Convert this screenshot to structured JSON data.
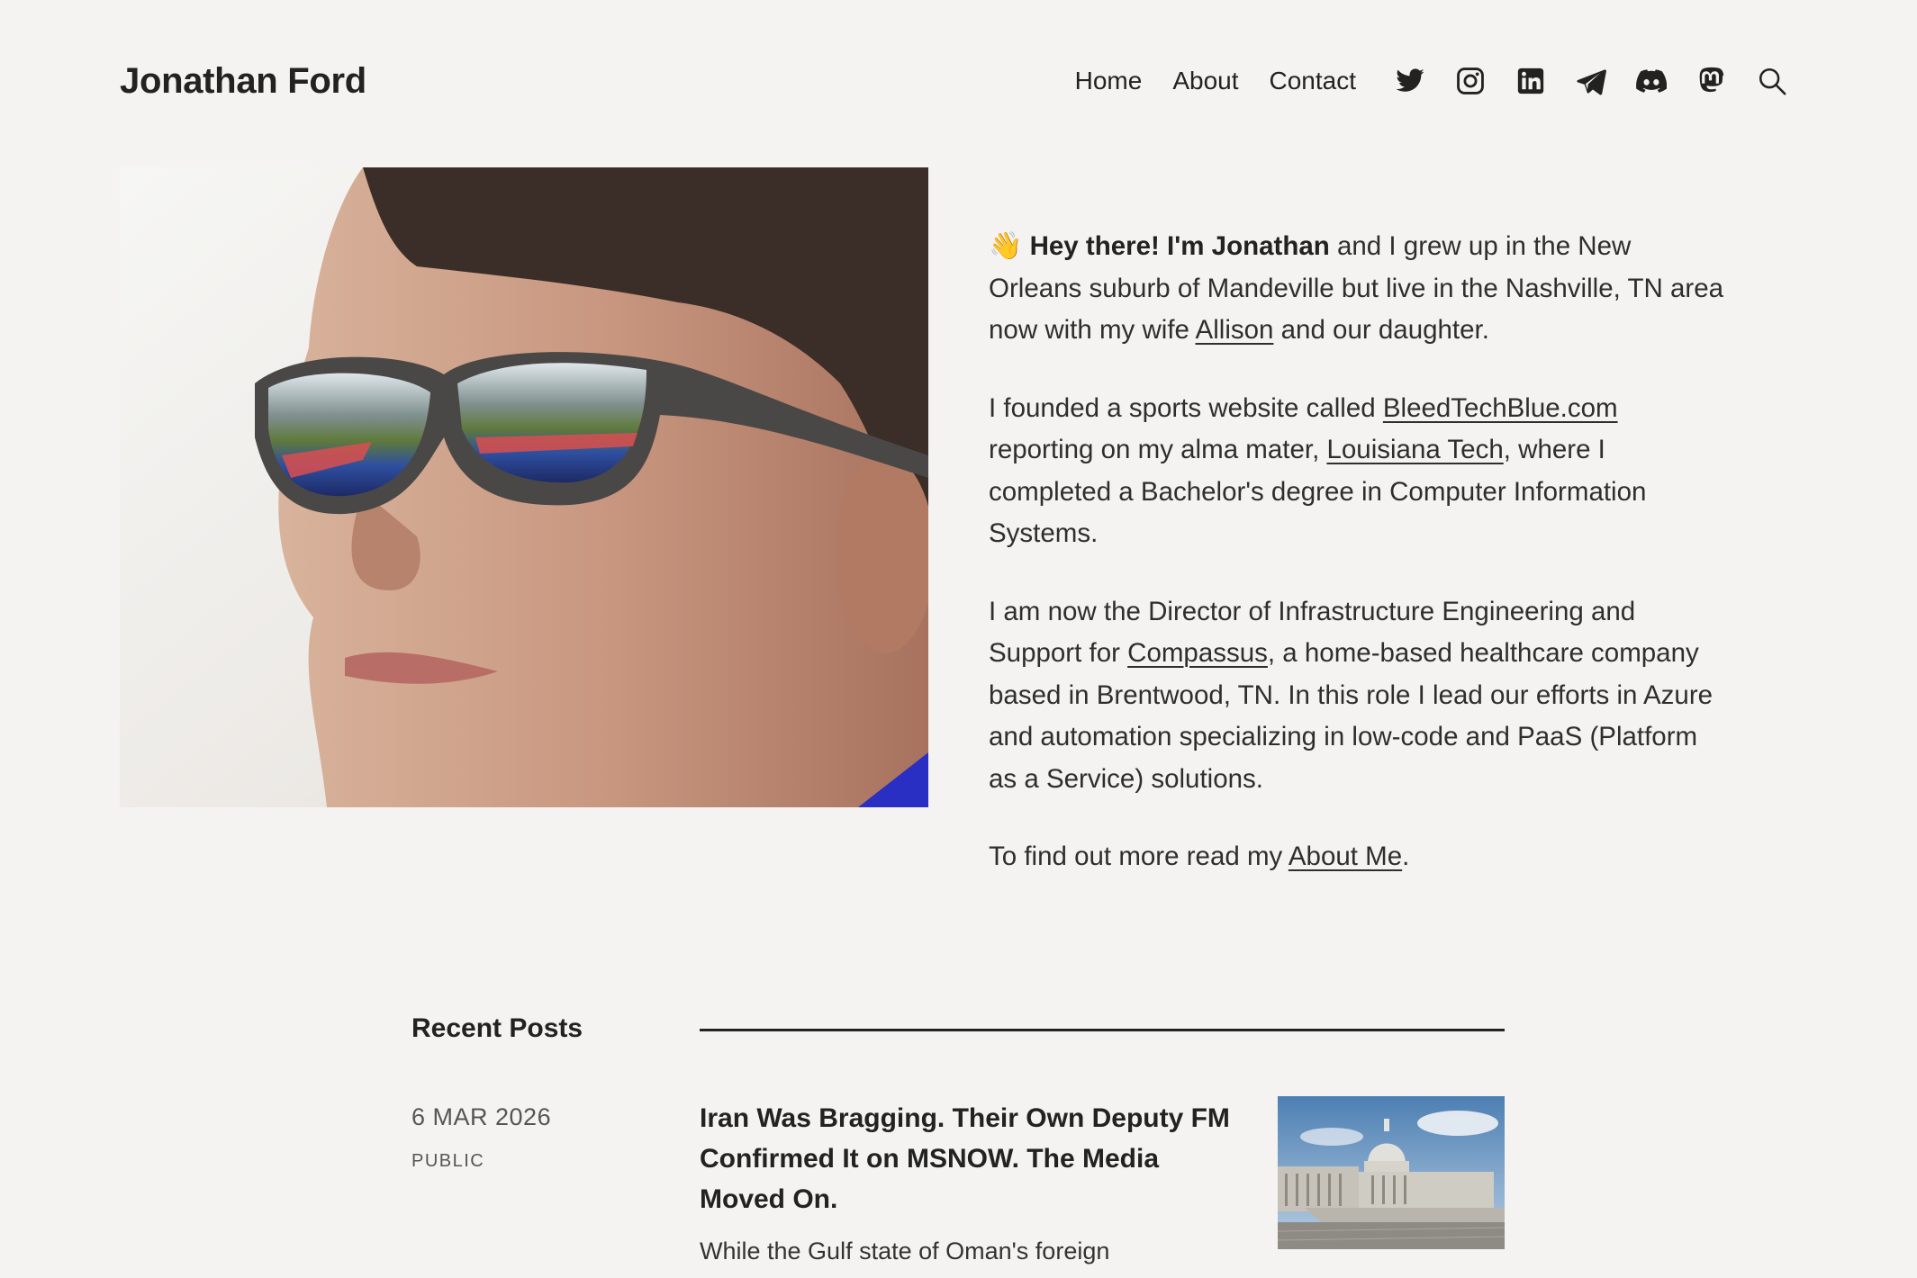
{
  "site": {
    "title": "Jonathan Ford"
  },
  "nav": {
    "links": [
      "Home",
      "About",
      "Contact"
    ],
    "icons": [
      "twitter-icon",
      "instagram-icon",
      "linkedin-icon",
      "telegram-icon",
      "discord-icon",
      "mastodon-icon",
      "search-icon"
    ]
  },
  "hero": {
    "photo": "portrait-photo",
    "intro": {
      "wave": "👋",
      "greeting": "Hey there! I'm Jonathan",
      "p1_text_a": " and I grew up in the New Orleans suburb of Mandeville but live in the Nashville, TN area now with my wife ",
      "p1_link": "Allison",
      "p1_text_b": " and our daughter.",
      "p2_text_a": "I founded a sports website called ",
      "p2_link_a": "BleedTechBlue.com",
      "p2_text_b": " reporting on my alma mater, ",
      "p2_link_b": "Louisiana Tech",
      "p2_text_c": ", where I completed a Bachelor's degree in Computer Information Systems.",
      "p3_text_a": "I am now the Director of Infrastructure Engineering and Support for ",
      "p3_link": "Compassus",
      "p3_text_b": ", a home-based healthcare company based in Brentwood, TN. In this role I lead our efforts in Azure and automation specializing in low-code and PaaS (Platform as a Service) solutions.",
      "p4_text_a": "To find out more read my ",
      "p4_link": "About Me",
      "p4_text_b": "."
    }
  },
  "recent_posts": {
    "heading": "Recent Posts",
    "items": [
      {
        "date": "6 MAR 2026",
        "visibility": "PUBLIC",
        "title": "Iran Was Bragging. Their Own Deputy FM Confirmed It on MSNOW. The Media Moved On.",
        "excerpt": "While the Gulf state of Oman's foreign",
        "thumbnail": "capitol-building-image"
      }
    ]
  },
  "colors": {
    "background": "#f4f3f1",
    "text": "#222222"
  }
}
